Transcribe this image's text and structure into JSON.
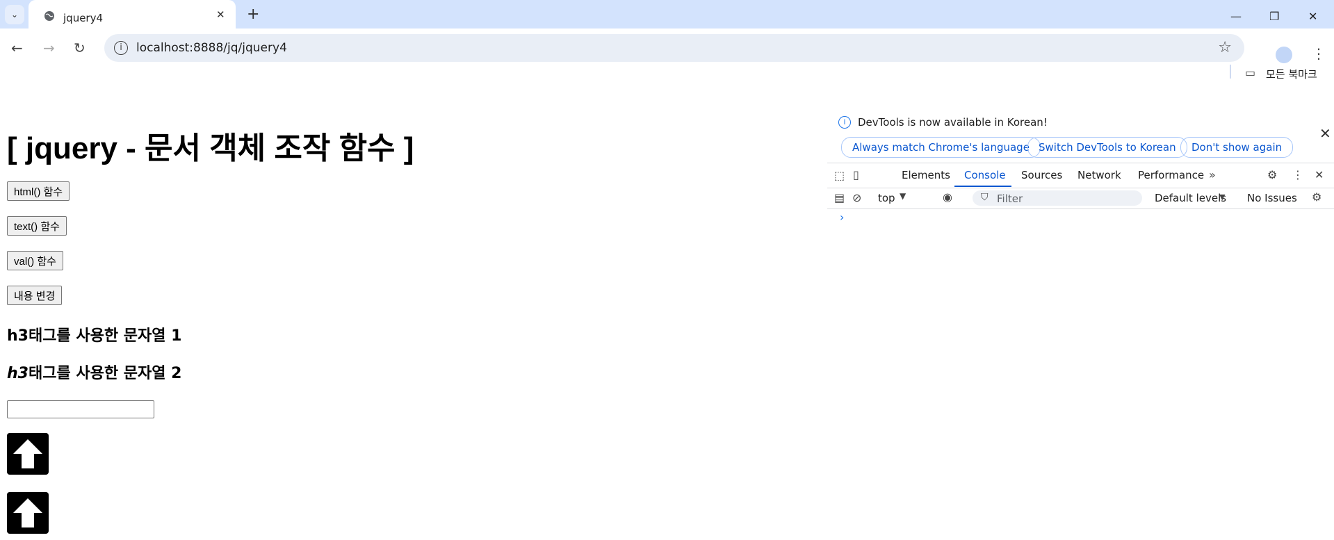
{
  "browser": {
    "tab_title": "jquery4",
    "url": "localhost:8888/jq/jquery4",
    "bookmarks_label": "모든 북마크"
  },
  "page": {
    "title": "[ jquery - 문서 객체 조작 함수 ]",
    "buttons": {
      "html": "html() 함수",
      "text": "text() 함수",
      "val": "val() 함수",
      "change": "내용 변경"
    },
    "h3_1": "h3태그를 사용한 문자열 1",
    "h3_2_prefix": "h3",
    "h3_2_suffix": "태그를 사용한 문자열 2",
    "input_value": ""
  },
  "devtools": {
    "notice": "DevTools is now available in Korean!",
    "btn_match": "Always match Chrome's language",
    "btn_switch": "Switch DevTools to Korean",
    "btn_dont_show": "Don't show again",
    "tabs": [
      "Elements",
      "Console",
      "Sources",
      "Network",
      "Performance"
    ],
    "active_tab": "Console",
    "context": "top",
    "filter_placeholder": "Filter",
    "levels": "Default levels",
    "issues": "No Issues"
  },
  "icons": {
    "arrow": "up-arrow-icon",
    "accent": "#0b57d0"
  }
}
